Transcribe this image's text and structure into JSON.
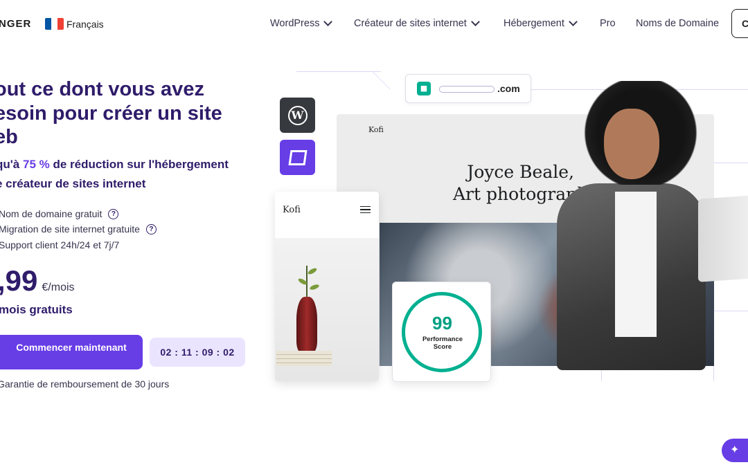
{
  "nav": {
    "logo": "NGER",
    "language": "Français",
    "flag_colors": [
      "#0055a4",
      "#ffffff",
      "#ef4135"
    ],
    "menu": [
      {
        "label": "WordPress",
        "has_dropdown": true
      },
      {
        "label": "Créateur de sites internet",
        "has_dropdown": true
      },
      {
        "label": "Hébergement",
        "has_dropdown": true
      },
      {
        "label": "Pro",
        "has_dropdown": false
      },
      {
        "label": "Noms de Domaine",
        "has_dropdown": false
      }
    ],
    "right_button": "C"
  },
  "hero": {
    "title_line1": "out ce dont vous avez",
    "title_line2": "esoin pour créer un site",
    "title_line3": "eb",
    "subtitle_prefix": "qu'à ",
    "subtitle_discount": "75 %",
    "subtitle_mid": " de réduction sur l'hébergement",
    "subtitle_line2": "e créateur de sites internet",
    "features": [
      {
        "label": "Nom de domaine gratuit",
        "has_help": true
      },
      {
        "label": "Migration de site internet gratuite",
        "has_help": true
      },
      {
        "label": "Support client 24h/24 et 7j/7",
        "has_help": false
      }
    ],
    "price": ",99",
    "price_unit": "€/mois",
    "free_months": "mois gratuits",
    "cta_label": "Commencer maintenant",
    "timer": "02 : 11 : 09 : 02",
    "guarantee": "Garantie de remboursement de 30 jours"
  },
  "illustration": {
    "url_suffix": ".com",
    "site_brand": "Kofi",
    "site_heading_line1": "Joyce Beale,",
    "site_heading_line2": "Art photograph",
    "mobile_brand": "Kofi",
    "score_value": "99",
    "score_label": "Performance Score"
  },
  "colors": {
    "brand": "#673de6",
    "heading": "#2f1c6a",
    "score": "#00b090",
    "timer_bg": "#ebe4ff"
  },
  "icons": [
    "chevron-down-icon",
    "help-icon",
    "lock-icon",
    "wordpress-icon",
    "hostinger-icon",
    "menu-icon",
    "sparkle-icon"
  ]
}
